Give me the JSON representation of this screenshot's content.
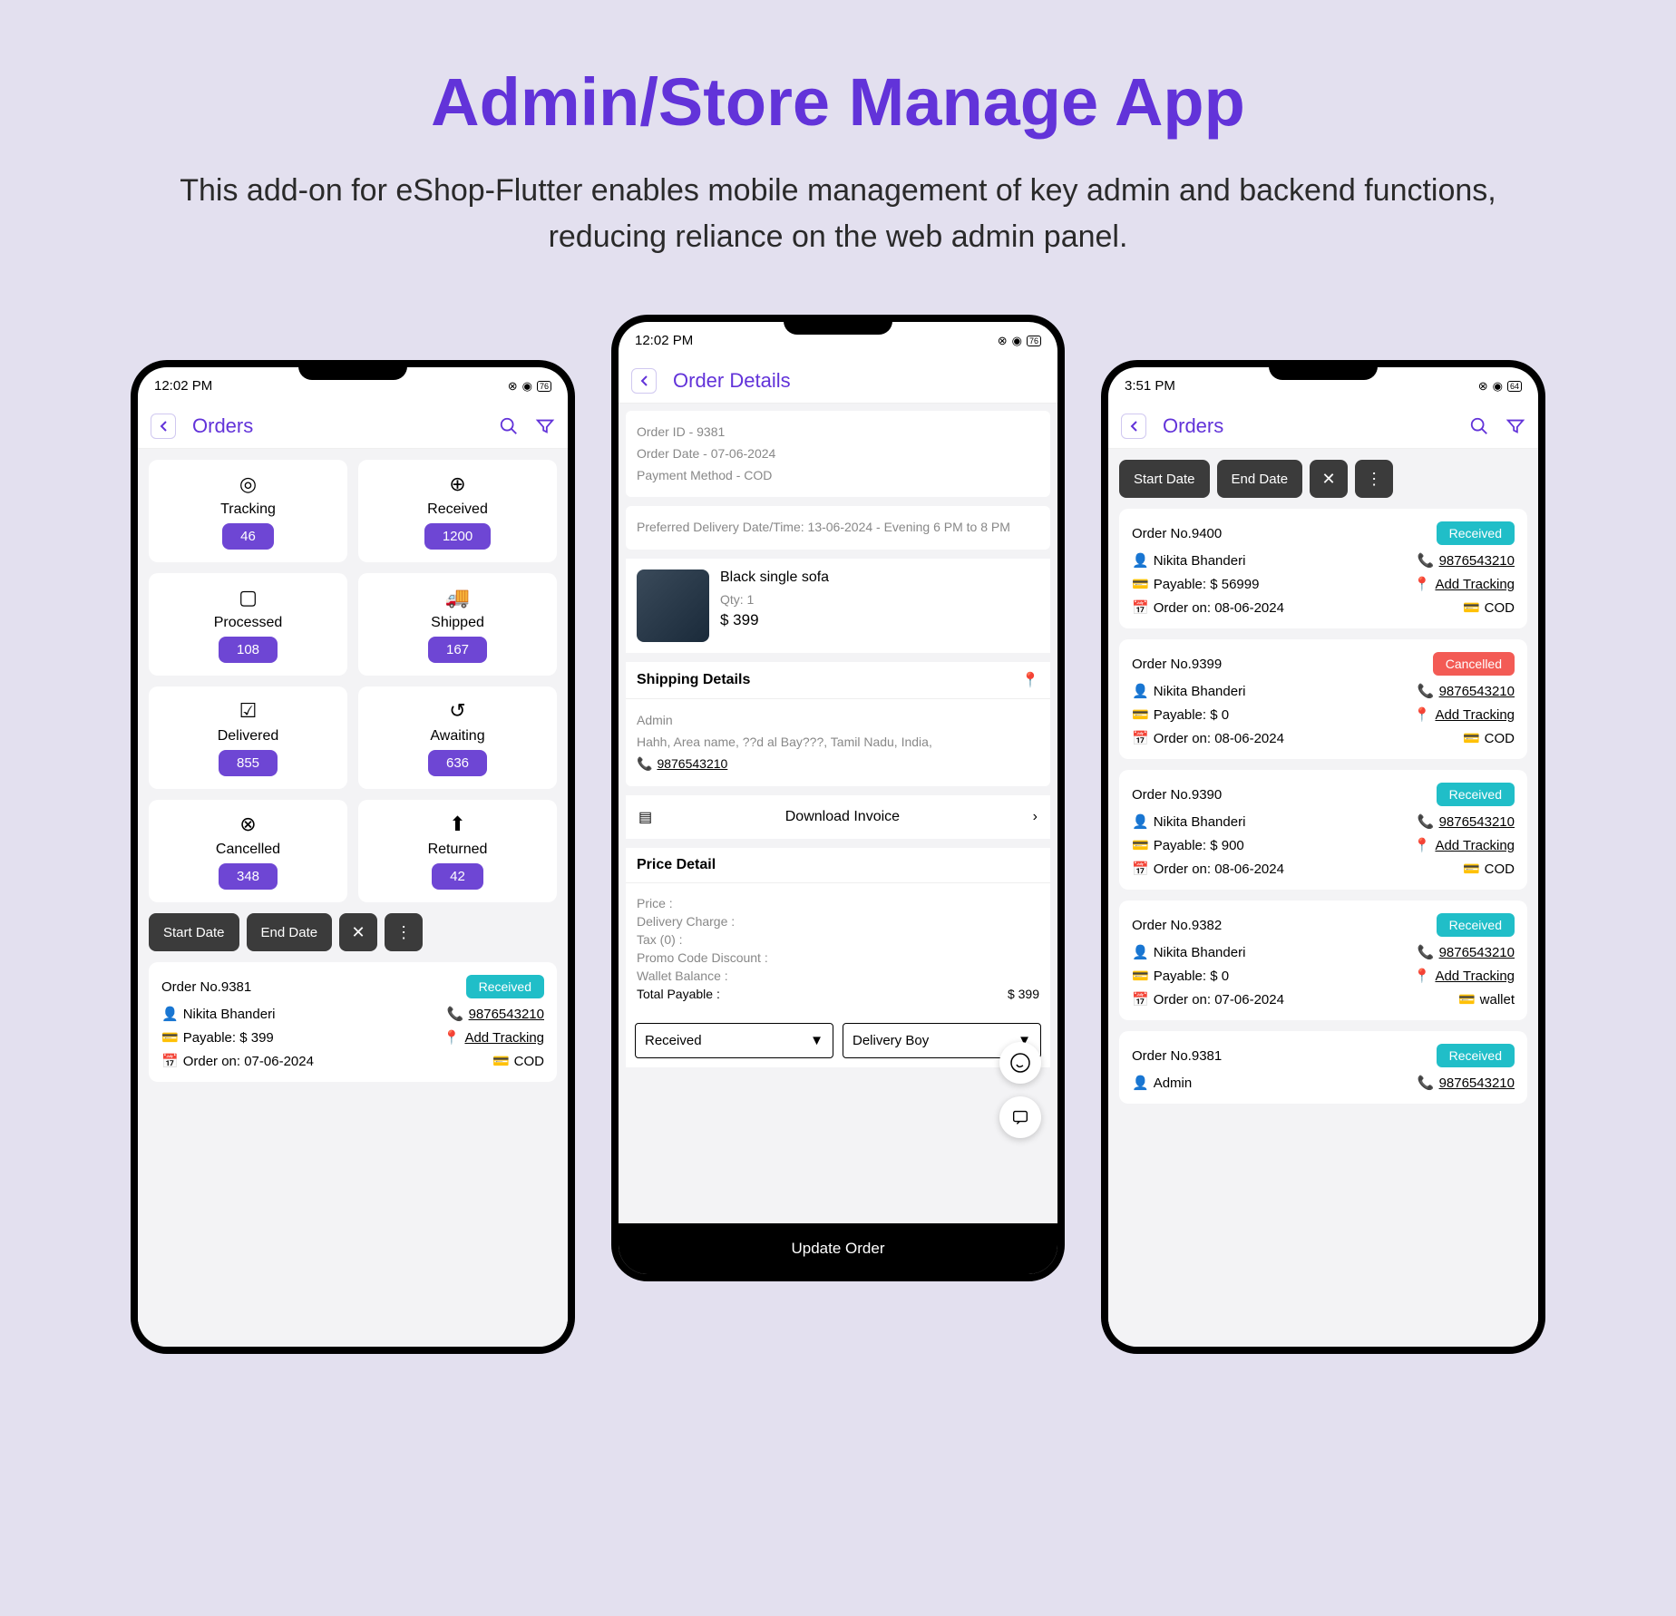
{
  "page": {
    "title": "Admin/Store Manage App",
    "subtitle": "This add-on for eShop-Flutter enables mobile management of key admin and backend functions, reducing reliance on the web admin panel."
  },
  "phone1": {
    "time": "12:02 PM",
    "battery": "76",
    "header": "Orders",
    "tiles": [
      {
        "label": "Tracking",
        "count": "46"
      },
      {
        "label": "Received",
        "count": "1200"
      },
      {
        "label": "Processed",
        "count": "108"
      },
      {
        "label": "Shipped",
        "count": "167"
      },
      {
        "label": "Delivered",
        "count": "855"
      },
      {
        "label": "Awaiting",
        "count": "636"
      },
      {
        "label": "Cancelled",
        "count": "348"
      },
      {
        "label": "Returned",
        "count": "42"
      }
    ],
    "start_date": "Start Date",
    "end_date": "End Date",
    "order": {
      "no": "Order No.9381",
      "status": "Received",
      "name": "Nikita Bhanderi",
      "phone": "9876543210",
      "payable": "Payable: $ 399",
      "add_tracking": "Add Tracking",
      "order_on": "Order on: 07-06-2024",
      "method": "COD"
    }
  },
  "phone2": {
    "time": "12:02 PM",
    "battery": "76",
    "header": "Order Details",
    "info": {
      "order_id": "Order ID - 9381",
      "order_date": "Order Date - 07-06-2024",
      "payment": "Payment Method - COD",
      "delivery": "Preferred Delivery Date/Time: 13-06-2024 - Evening 6 PM to 8 PM"
    },
    "product": {
      "name": "Black single sofa",
      "qty": "Qty:  1",
      "price": "$ 399"
    },
    "shipping": {
      "header": "Shipping Details",
      "name": "Admin",
      "address": "Hahh, Area name, ??d al Bay???, Tamil Nadu, India,",
      "phone": "9876543210"
    },
    "download": "Download Invoice",
    "price_detail": {
      "header": "Price Detail",
      "price": "Price :",
      "delivery": "Delivery Charge :",
      "tax": "Tax (0) :",
      "promo": "Promo Code Discount :",
      "wallet": "Wallet Balance :",
      "total": "Total Payable :",
      "total_val": "$ 399"
    },
    "dd_status": "Received",
    "dd_boy": "Delivery Boy",
    "update": "Update Order"
  },
  "phone3": {
    "time": "3:51 PM",
    "battery": "64",
    "header": "Orders",
    "start_date": "Start Date",
    "end_date": "End Date",
    "orders": [
      {
        "no": "Order No.9400",
        "status": "Received",
        "status_cls": "received",
        "name": "Nikita Bhanderi",
        "phone": "9876543210",
        "payable": "Payable: $ 56999",
        "add_tracking": "Add Tracking",
        "order_on": "Order on: 08-06-2024",
        "method": "COD"
      },
      {
        "no": "Order No.9399",
        "status": "Cancelled",
        "status_cls": "cancelled",
        "name": "Nikita Bhanderi",
        "phone": "9876543210",
        "payable": "Payable: $ 0",
        "add_tracking": "Add Tracking",
        "order_on": "Order on: 08-06-2024",
        "method": "COD"
      },
      {
        "no": "Order No.9390",
        "status": "Received",
        "status_cls": "received",
        "name": "Nikita Bhanderi",
        "phone": "9876543210",
        "payable": "Payable: $ 900",
        "add_tracking": "Add Tracking",
        "order_on": "Order on: 08-06-2024",
        "method": "COD"
      },
      {
        "no": "Order No.9382",
        "status": "Received",
        "status_cls": "received",
        "name": "Nikita Bhanderi",
        "phone": "9876543210",
        "payable": "Payable: $ 0",
        "add_tracking": "Add Tracking",
        "order_on": "Order on: 07-06-2024",
        "method": "wallet"
      },
      {
        "no": "Order No.9381",
        "status": "Received",
        "status_cls": "received",
        "name": "Admin",
        "phone": "9876543210"
      }
    ]
  }
}
